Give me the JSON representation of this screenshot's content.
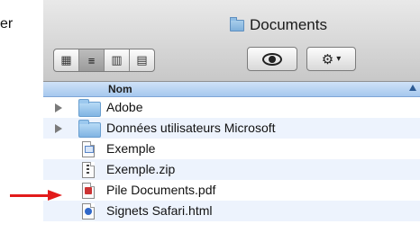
{
  "partial_text": "er",
  "window": {
    "title": "Documents"
  },
  "toolbar": {
    "view_icons": [
      {
        "name": "icon-view-icon",
        "glyph": "▦"
      },
      {
        "name": "list-view-icon",
        "glyph": "≡"
      },
      {
        "name": "column-view-icon",
        "glyph": "▥"
      },
      {
        "name": "coverflow-view-icon",
        "glyph": "▤"
      }
    ],
    "eye_icon": "eye-icon",
    "gear_icon": "gear-icon",
    "gear_glyph": "⚙▾"
  },
  "list": {
    "header": "Nom",
    "rows": [
      {
        "name": "Adobe",
        "type": "folder"
      },
      {
        "name": "Données utilisateurs Microsoft",
        "type": "folder"
      },
      {
        "name": "Exemple",
        "type": "exec"
      },
      {
        "name": "Exemple.zip",
        "type": "zip"
      },
      {
        "name": "Pile Documents.pdf",
        "type": "pdf"
      },
      {
        "name": "Signets Safari.html",
        "type": "html"
      }
    ]
  }
}
